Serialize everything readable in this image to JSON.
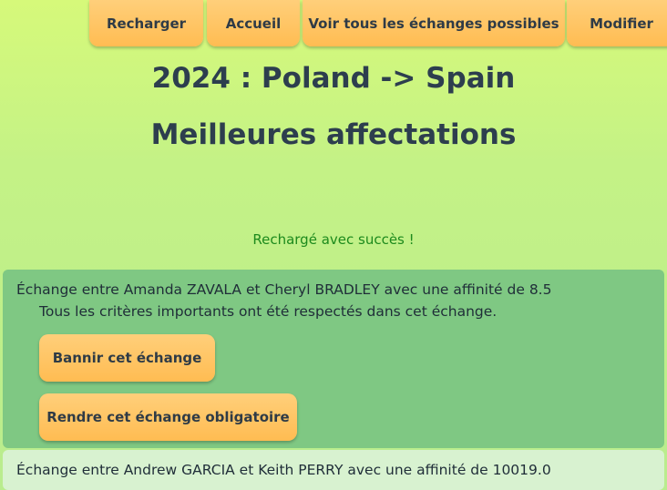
{
  "nav": {
    "reload_label": "Recharger",
    "home_label": "Accueil",
    "all_exchanges_label": "Voir tous les échanges possibles",
    "edit_label": "Modifier"
  },
  "header": {
    "title": "2024 : Poland -> Spain",
    "subtitle": "Meilleures affectations"
  },
  "status": {
    "message": "Rechargé avec succès !",
    "color": "#1d8a1d"
  },
  "exchanges": [
    {
      "summary": "Échange entre Amanda ZAVALA et Cheryl BRADLEY avec une affinité de 8.5",
      "detail": "Tous les critères importants ont été respectés dans cet échange.",
      "ban_label": "Bannir cet échange",
      "mandatory_label": "Rendre cet échange obligatoire",
      "background": "#7fc883"
    },
    {
      "summary": "Échange entre Andrew GARCIA et Keith PERRY avec une affinité de 10019.0",
      "background": "#d8f2d0"
    }
  ],
  "colors": {
    "button_accent": "#ffbc52",
    "title_text": "#2d3e4e"
  }
}
